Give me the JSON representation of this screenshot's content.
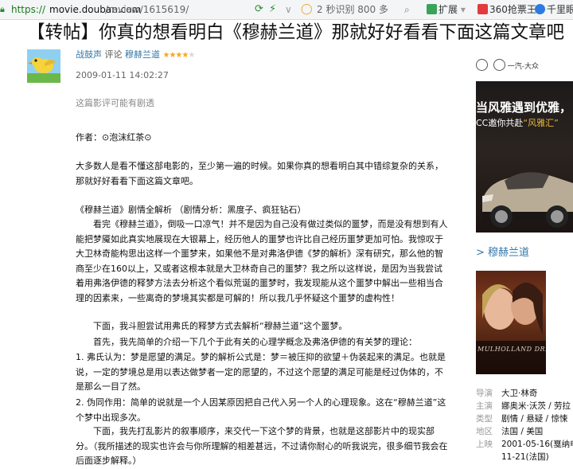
{
  "browser": {
    "url_scheme": "https://",
    "url_host": "movie.douban.com",
    "url_path": "/review/1615619/",
    "search_text": "2 秒识别 800 多",
    "ext_label": "扩展",
    "ext2_label": "360抢票王",
    "ext3_label": "千里眼"
  },
  "title": "【转帖】你真的想看明白《穆赫兰道》那就好好看看下面这篇文章吧",
  "author": {
    "name": "战鼓声",
    "verb": "评论",
    "movie": "穆赫兰道",
    "stars_on": "★★★★",
    "stars_off": "★",
    "rating": 4,
    "date": "2009-01-11 14:02:27"
  },
  "spoiler": "这篇影评可能有剧透",
  "article": {
    "author_line": "作者：⊙泡沫红茶⊙",
    "intro": "大多数人是看不懂这部电影的，至少第一遍的时候。如果你真的想看明白其中错综复杂的关系，那就好好看看下面这篇文章吧。",
    "review_head": "《穆赫兰道》剧情全解析 （剧情分析：黑度子、疯狂钻石）",
    "review_body": "看完《穆赫兰道》，倒吸一口凉气！并不是因为自己没有做过类似的噩梦，而是没有想到有人能把梦魇如此真实地展现在大银幕上，经历他人的噩梦也许比自己经历噩梦更加可怕。我惊叹于大卫林奇能构思出这样一个噩梦来，如果他不是对弗洛伊德《梦的解析》深有研究，那么他的智商至少在160以上，又或者这根本就是大卫林奇自己的噩梦？我之所以这样说，是因为当我尝试着用弗洛伊德的释梦方法去分析这个看似荒诞的噩梦时，我发现能从这个噩梦中解出一些相当合理的因素来，一些离奇的梦境其实都是可解的！所以我几乎怀疑这个噩梦的虚构性！",
    "hypothesis": "下面，我斗胆尝试用弗氏的释梦方式去解析“穆赫兰道”这个噩梦。",
    "first": "首先，我先简单的介绍一下几个于此有关的心理学概念及弗洛伊德的有关梦的理论：",
    "point1": "1. 弗氏认为：梦是愿望的满足。梦的解析公式是：梦＝被压抑的欲望＋伪装起来的满足。也就是说，一定的梦境总是用以表达做梦者一定的愿望的，不过这个愿望的满足可能是经过伪体的，不是那么一目了然。",
    "point2": "2. 伪同作用：简单的说就是一个人因某原因把自己代入另一个人的心理现象。这在“穆赫兰道”这个梦中出现多次。",
    "ending": "下面，我先打乱影片的叙事顺序，来交代一下这个梦的背景，也就是这部影片中的现实部分。（我所描述的现实也许会与你所理解的相差甚远，不过请你耐心的听我说完，很多细节我会在后面逐步解释。）"
  },
  "sidebar": {
    "brand_text": "一汽-大众",
    "ad_headline": "当风雅遇到优雅，",
    "ad_sub_pre": "CC邀你共赴",
    "ad_sub_accent": "“风雅汇”",
    "movie_link": "> 穆赫兰道",
    "poster_title": "MULHOLLAND DRIVE",
    "info": [
      {
        "label": "导演",
        "value": "大卫·林奇"
      },
      {
        "label": "主演",
        "value": "娜奥米·沃茨 / 劳拉"
      },
      {
        "label": "类型",
        "value": "剧情 / 悬疑 / 惊悚"
      },
      {
        "label": "地区",
        "value": "法国 / 美国"
      },
      {
        "label": "上映",
        "value": "2001-05-16(戛纳电"
      },
      {
        "label": "",
        "value": "11-21(法国)"
      }
    ]
  }
}
